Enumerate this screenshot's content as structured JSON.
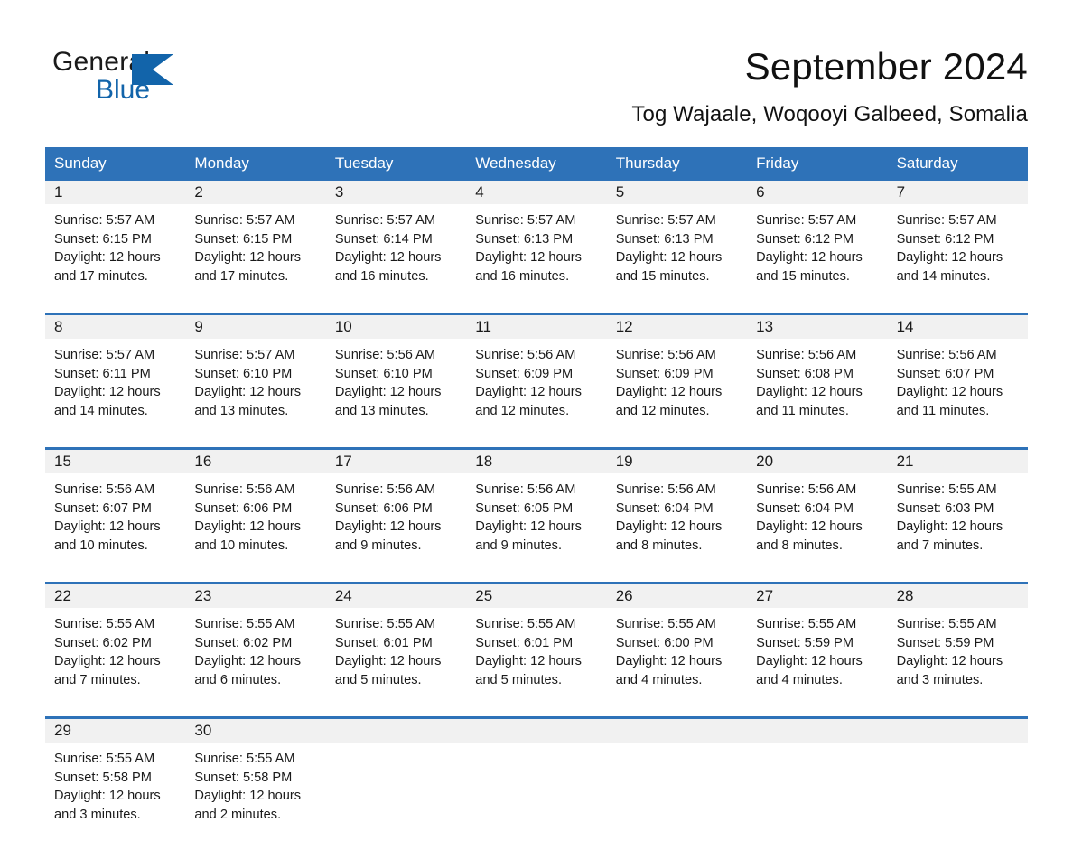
{
  "brand": {
    "name_part1": "General",
    "name_part2": "Blue",
    "triangle_icon": "triangle-icon",
    "accent_color": "#1264aa"
  },
  "header": {
    "title": "September 2024",
    "subtitle": "Tog Wajaale, Woqooyi Galbeed, Somalia"
  },
  "calendar": {
    "header_bg": "#2e72b8",
    "header_text_color": "#ffffff",
    "date_band_bg": "#f1f1f1",
    "weekdays": [
      "Sunday",
      "Monday",
      "Tuesday",
      "Wednesday",
      "Thursday",
      "Friday",
      "Saturday"
    ],
    "weeks": [
      [
        {
          "day": "1",
          "sunrise": "Sunrise: 5:57 AM",
          "sunset": "Sunset: 6:15 PM",
          "daylight1": "Daylight: 12 hours",
          "daylight2": "and 17 minutes."
        },
        {
          "day": "2",
          "sunrise": "Sunrise: 5:57 AM",
          "sunset": "Sunset: 6:15 PM",
          "daylight1": "Daylight: 12 hours",
          "daylight2": "and 17 minutes."
        },
        {
          "day": "3",
          "sunrise": "Sunrise: 5:57 AM",
          "sunset": "Sunset: 6:14 PM",
          "daylight1": "Daylight: 12 hours",
          "daylight2": "and 16 minutes."
        },
        {
          "day": "4",
          "sunrise": "Sunrise: 5:57 AM",
          "sunset": "Sunset: 6:13 PM",
          "daylight1": "Daylight: 12 hours",
          "daylight2": "and 16 minutes."
        },
        {
          "day": "5",
          "sunrise": "Sunrise: 5:57 AM",
          "sunset": "Sunset: 6:13 PM",
          "daylight1": "Daylight: 12 hours",
          "daylight2": "and 15 minutes."
        },
        {
          "day": "6",
          "sunrise": "Sunrise: 5:57 AM",
          "sunset": "Sunset: 6:12 PM",
          "daylight1": "Daylight: 12 hours",
          "daylight2": "and 15 minutes."
        },
        {
          "day": "7",
          "sunrise": "Sunrise: 5:57 AM",
          "sunset": "Sunset: 6:12 PM",
          "daylight1": "Daylight: 12 hours",
          "daylight2": "and 14 minutes."
        }
      ],
      [
        {
          "day": "8",
          "sunrise": "Sunrise: 5:57 AM",
          "sunset": "Sunset: 6:11 PM",
          "daylight1": "Daylight: 12 hours",
          "daylight2": "and 14 minutes."
        },
        {
          "day": "9",
          "sunrise": "Sunrise: 5:57 AM",
          "sunset": "Sunset: 6:10 PM",
          "daylight1": "Daylight: 12 hours",
          "daylight2": "and 13 minutes."
        },
        {
          "day": "10",
          "sunrise": "Sunrise: 5:56 AM",
          "sunset": "Sunset: 6:10 PM",
          "daylight1": "Daylight: 12 hours",
          "daylight2": "and 13 minutes."
        },
        {
          "day": "11",
          "sunrise": "Sunrise: 5:56 AM",
          "sunset": "Sunset: 6:09 PM",
          "daylight1": "Daylight: 12 hours",
          "daylight2": "and 12 minutes."
        },
        {
          "day": "12",
          "sunrise": "Sunrise: 5:56 AM",
          "sunset": "Sunset: 6:09 PM",
          "daylight1": "Daylight: 12 hours",
          "daylight2": "and 12 minutes."
        },
        {
          "day": "13",
          "sunrise": "Sunrise: 5:56 AM",
          "sunset": "Sunset: 6:08 PM",
          "daylight1": "Daylight: 12 hours",
          "daylight2": "and 11 minutes."
        },
        {
          "day": "14",
          "sunrise": "Sunrise: 5:56 AM",
          "sunset": "Sunset: 6:07 PM",
          "daylight1": "Daylight: 12 hours",
          "daylight2": "and 11 minutes."
        }
      ],
      [
        {
          "day": "15",
          "sunrise": "Sunrise: 5:56 AM",
          "sunset": "Sunset: 6:07 PM",
          "daylight1": "Daylight: 12 hours",
          "daylight2": "and 10 minutes."
        },
        {
          "day": "16",
          "sunrise": "Sunrise: 5:56 AM",
          "sunset": "Sunset: 6:06 PM",
          "daylight1": "Daylight: 12 hours",
          "daylight2": "and 10 minutes."
        },
        {
          "day": "17",
          "sunrise": "Sunrise: 5:56 AM",
          "sunset": "Sunset: 6:06 PM",
          "daylight1": "Daylight: 12 hours",
          "daylight2": "and 9 minutes."
        },
        {
          "day": "18",
          "sunrise": "Sunrise: 5:56 AM",
          "sunset": "Sunset: 6:05 PM",
          "daylight1": "Daylight: 12 hours",
          "daylight2": "and 9 minutes."
        },
        {
          "day": "19",
          "sunrise": "Sunrise: 5:56 AM",
          "sunset": "Sunset: 6:04 PM",
          "daylight1": "Daylight: 12 hours",
          "daylight2": "and 8 minutes."
        },
        {
          "day": "20",
          "sunrise": "Sunrise: 5:56 AM",
          "sunset": "Sunset: 6:04 PM",
          "daylight1": "Daylight: 12 hours",
          "daylight2": "and 8 minutes."
        },
        {
          "day": "21",
          "sunrise": "Sunrise: 5:55 AM",
          "sunset": "Sunset: 6:03 PM",
          "daylight1": "Daylight: 12 hours",
          "daylight2": "and 7 minutes."
        }
      ],
      [
        {
          "day": "22",
          "sunrise": "Sunrise: 5:55 AM",
          "sunset": "Sunset: 6:02 PM",
          "daylight1": "Daylight: 12 hours",
          "daylight2": "and 7 minutes."
        },
        {
          "day": "23",
          "sunrise": "Sunrise: 5:55 AM",
          "sunset": "Sunset: 6:02 PM",
          "daylight1": "Daylight: 12 hours",
          "daylight2": "and 6 minutes."
        },
        {
          "day": "24",
          "sunrise": "Sunrise: 5:55 AM",
          "sunset": "Sunset: 6:01 PM",
          "daylight1": "Daylight: 12 hours",
          "daylight2": "and 5 minutes."
        },
        {
          "day": "25",
          "sunrise": "Sunrise: 5:55 AM",
          "sunset": "Sunset: 6:01 PM",
          "daylight1": "Daylight: 12 hours",
          "daylight2": "and 5 minutes."
        },
        {
          "day": "26",
          "sunrise": "Sunrise: 5:55 AM",
          "sunset": "Sunset: 6:00 PM",
          "daylight1": "Daylight: 12 hours",
          "daylight2": "and 4 minutes."
        },
        {
          "day": "27",
          "sunrise": "Sunrise: 5:55 AM",
          "sunset": "Sunset: 5:59 PM",
          "daylight1": "Daylight: 12 hours",
          "daylight2": "and 4 minutes."
        },
        {
          "day": "28",
          "sunrise": "Sunrise: 5:55 AM",
          "sunset": "Sunset: 5:59 PM",
          "daylight1": "Daylight: 12 hours",
          "daylight2": "and 3 minutes."
        }
      ],
      [
        {
          "day": "29",
          "sunrise": "Sunrise: 5:55 AM",
          "sunset": "Sunset: 5:58 PM",
          "daylight1": "Daylight: 12 hours",
          "daylight2": "and 3 minutes."
        },
        {
          "day": "30",
          "sunrise": "Sunrise: 5:55 AM",
          "sunset": "Sunset: 5:58 PM",
          "daylight1": "Daylight: 12 hours",
          "daylight2": "and 2 minutes."
        },
        {
          "day": "",
          "sunrise": "",
          "sunset": "",
          "daylight1": "",
          "daylight2": ""
        },
        {
          "day": "",
          "sunrise": "",
          "sunset": "",
          "daylight1": "",
          "daylight2": ""
        },
        {
          "day": "",
          "sunrise": "",
          "sunset": "",
          "daylight1": "",
          "daylight2": ""
        },
        {
          "day": "",
          "sunrise": "",
          "sunset": "",
          "daylight1": "",
          "daylight2": ""
        },
        {
          "day": "",
          "sunrise": "",
          "sunset": "",
          "daylight1": "",
          "daylight2": ""
        }
      ]
    ]
  }
}
